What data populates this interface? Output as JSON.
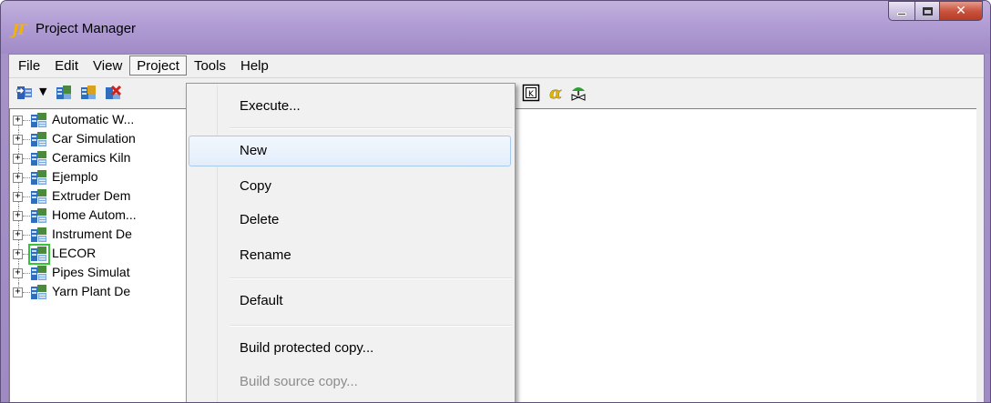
{
  "window": {
    "title": "Project Manager",
    "colors": {
      "titlebar": "#b19dd4",
      "close_button": "#c9553f",
      "selection_outline": "#36c23a"
    }
  },
  "menubar": {
    "items": [
      {
        "label": "File"
      },
      {
        "label": "Edit"
      },
      {
        "label": "View"
      },
      {
        "label": "Project"
      },
      {
        "label": "Tools"
      },
      {
        "label": "Help"
      }
    ],
    "open_menu": "Project"
  },
  "toolbar": {
    "icons": [
      "open-project-icon",
      "dropdown-arrow-icon",
      "new-project-icon",
      "copy-project-icon",
      "delete-project-icon",
      "keyboard-icon",
      "alpha-icon",
      "valve-icon"
    ]
  },
  "tree": {
    "items": [
      {
        "label": "Automatic W..."
      },
      {
        "label": "Car Simulation"
      },
      {
        "label": "Ceramics Kiln"
      },
      {
        "label": "Ejemplo"
      },
      {
        "label": "Extruder Dem"
      },
      {
        "label": "Home Autom..."
      },
      {
        "label": "Instrument De"
      },
      {
        "label": "LECOR"
      },
      {
        "label": "Pipes Simulat"
      },
      {
        "label": "Yarn Plant De"
      }
    ],
    "expander_symbol": "+"
  },
  "project_menu": {
    "items": [
      {
        "label": "Execute..."
      },
      {
        "label": "New"
      },
      {
        "label": "Copy"
      },
      {
        "label": "Delete"
      },
      {
        "label": "Rename"
      },
      {
        "label": "Default"
      },
      {
        "label": "Build protected copy..."
      },
      {
        "label": "Build source copy..."
      }
    ],
    "highlighted": "New",
    "disabled": "Build source copy..."
  }
}
